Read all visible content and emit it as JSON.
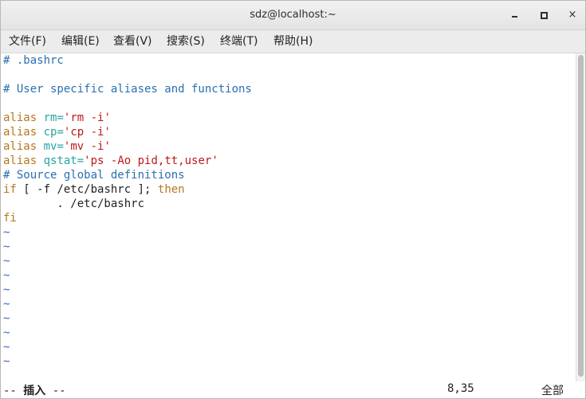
{
  "window": {
    "title": "sdz@localhost:~",
    "minimize_icon": "minimize-icon",
    "maximize_icon": "maximize-icon",
    "close_glyph": "×"
  },
  "menu": [
    {
      "label": "文件(F)"
    },
    {
      "label": "编辑(E)"
    },
    {
      "label": "查看(V)"
    },
    {
      "label": "搜索(S)"
    },
    {
      "label": "终端(T)"
    },
    {
      "label": "帮助(H)"
    }
  ],
  "editor": {
    "line1": "# .bashrc",
    "line3": "# User specific aliases and functions",
    "alias_kw": "alias",
    "alias1_name": "rm=",
    "alias1_val": "'rm -i'",
    "alias2_name": "cp=",
    "alias2_val": "'cp -i'",
    "alias3_name": "mv=",
    "alias3_val": "'mv -i'",
    "alias4_name": "qstat=",
    "alias4_val": "'ps -Ao pid,tt,user'",
    "line9": "# Source global definitions",
    "if_kw": "if",
    "if_cond": "[ -f /etc/bashrc ];",
    "then_kw": "then",
    "source_line": "        . /etc/bashrc",
    "fi_kw": "fi",
    "tilde": "~"
  },
  "status": {
    "mode_prefix": "-- ",
    "mode": "插入",
    "mode_suffix": " --",
    "position": "8,35",
    "percent": "全部"
  }
}
